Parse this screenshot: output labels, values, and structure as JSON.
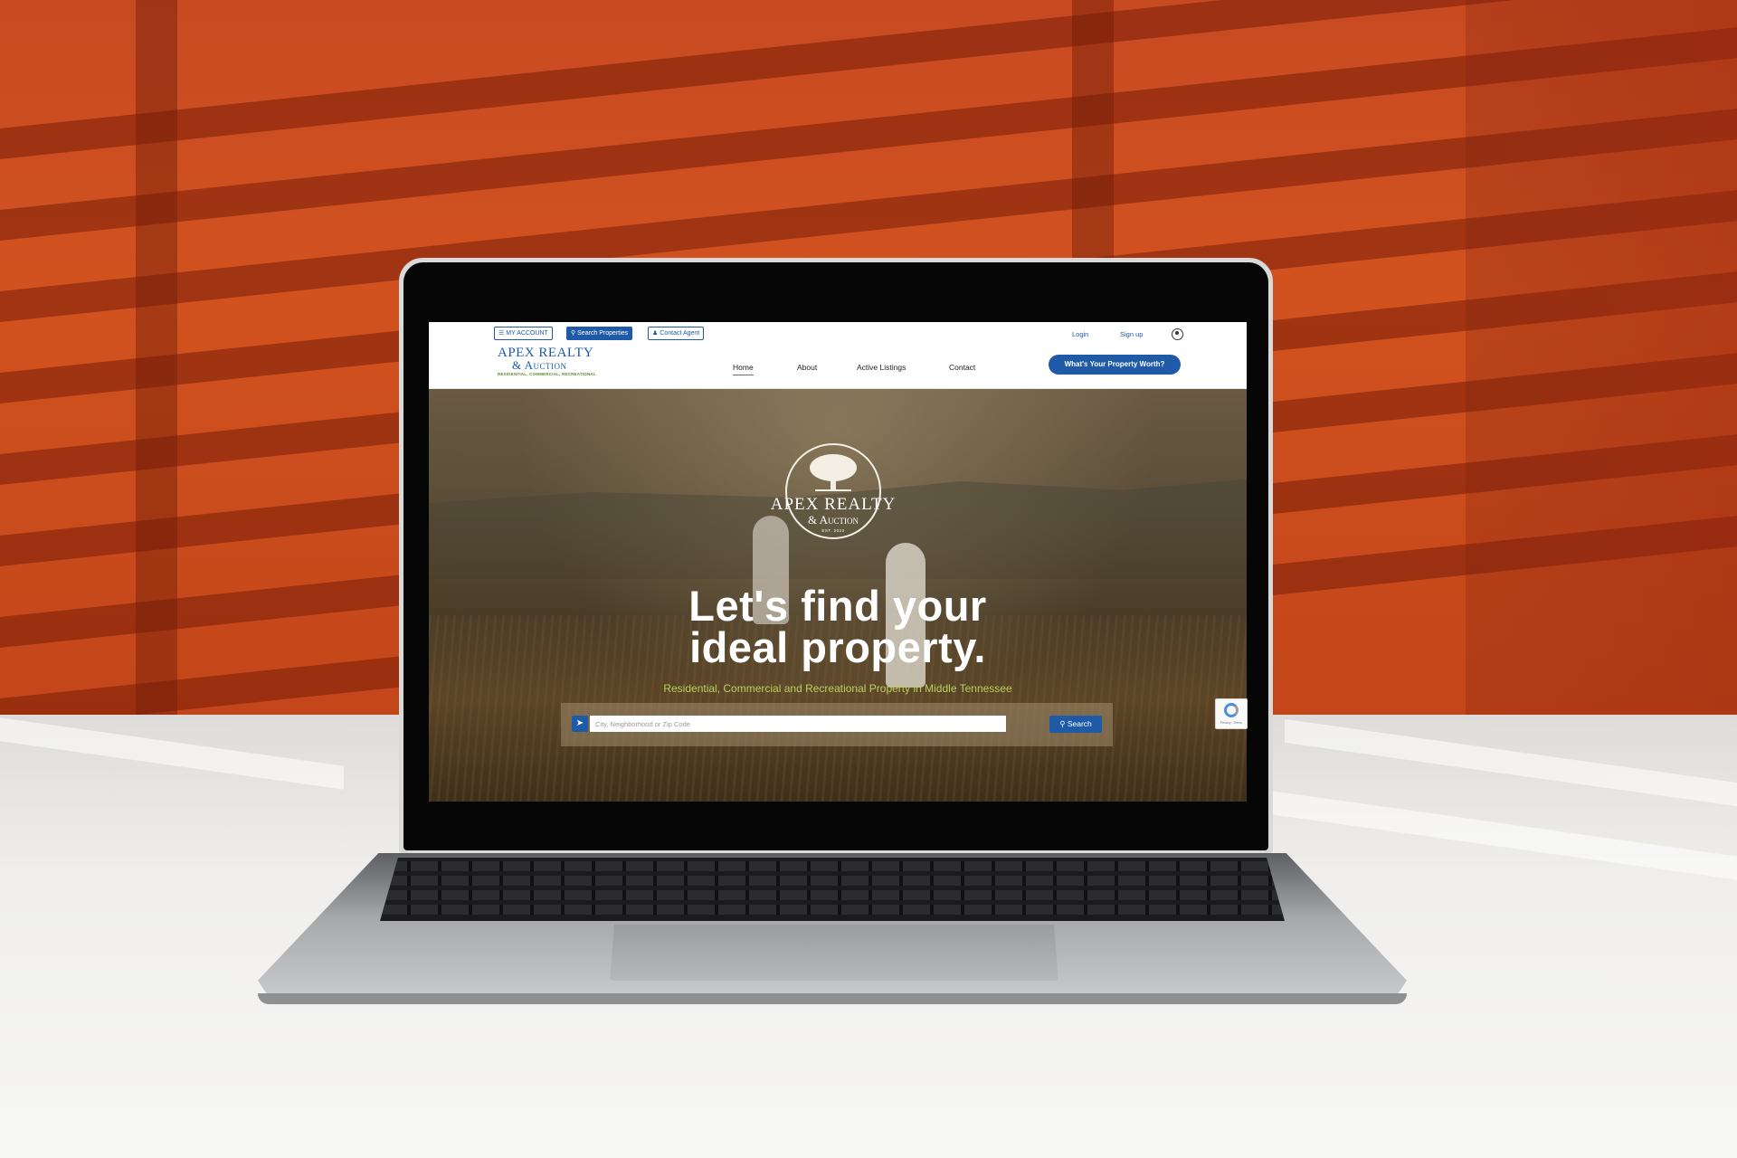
{
  "topbar": {
    "my_account": "MY ACCOUNT",
    "search_properties": "Search Properties",
    "contact_agent": "Contact Agent",
    "login": "Login",
    "signup": "Sign up"
  },
  "navbar": {
    "logo_line1": "APEX REALTY",
    "logo_line2": "& Auction",
    "logo_tagline": "RESIDENTIAL, COMMERCIAL, RECREATIONAL",
    "items": [
      "Home",
      "About",
      "Active Listings",
      "Contact"
    ],
    "active_item": "Home",
    "cta": "What's Your Property Worth?"
  },
  "hero": {
    "emblem_title": "APEX REALTY",
    "emblem_subtitle": "& Auction",
    "emblem_est": "EST. 2022",
    "headline_line1": "Let's find your",
    "headline_line2": "ideal property.",
    "subline": "Residential, Commercial and Recreational Property in Middle Tennessee",
    "search_placeholder": "City, Neighborhood or Zip Code",
    "search_button": "Search"
  },
  "recaptcha": {
    "text": "Privacy - Terms"
  },
  "colors": {
    "brand_blue": "#1f5aa6",
    "tagline_green": "#5c8a2e",
    "subline_green": "#b8d060",
    "backdrop_orange": "#c84a21"
  },
  "icons": [
    "menu-icon",
    "search-icon",
    "person-icon",
    "user-account-icon",
    "location-arrow-icon",
    "tree-icon",
    "recaptcha-icon"
  ]
}
